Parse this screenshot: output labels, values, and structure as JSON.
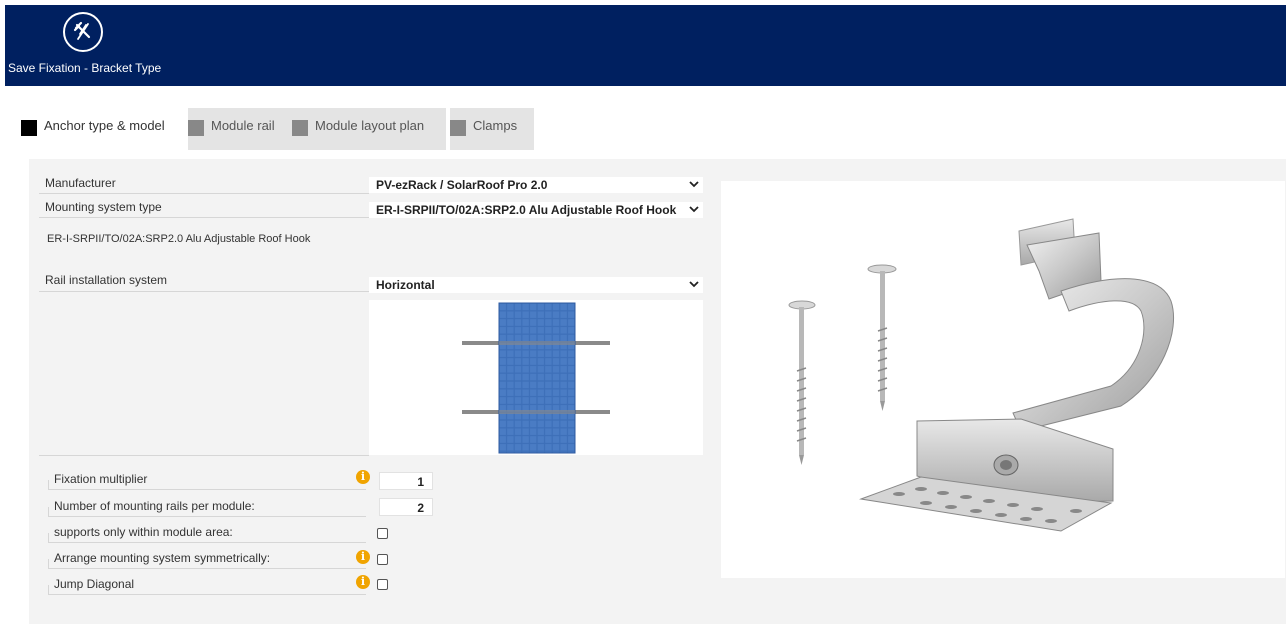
{
  "header": {
    "title": "Save Fixation - Bracket Type",
    "logo_icon": "wrench-screw-icon",
    "bg_color": "#002060"
  },
  "tabs": [
    {
      "label": "Anchor type & model",
      "active": true
    },
    {
      "label": "Module rail",
      "active": false
    },
    {
      "label": "Module layout plan",
      "active": false
    },
    {
      "label": "Clamps",
      "active": false
    }
  ],
  "form": {
    "manufacturer": {
      "label": "Manufacturer",
      "value": "PV-ezRack / SolarRoof Pro 2.0"
    },
    "mounting_type": {
      "label": "Mounting system type",
      "value": "ER-I-SRPII/TO/02A:SRP2.0 Alu Adjustable Roof Hook"
    },
    "selected_product": "ER-I-SRPII/TO/02A:SRP2.0 Alu Adjustable Roof Hook",
    "rail_system": {
      "label": "Rail installation system",
      "value": "Horizontal"
    }
  },
  "options": {
    "fixation_multiplier": {
      "label": "Fixation multiplier",
      "value": "1"
    },
    "rails_per_module": {
      "label": "Number of mounting rails per module:",
      "value": "2"
    },
    "supports_within_area": {
      "label": "supports only within module area:",
      "checked": false
    },
    "arrange_symmetric": {
      "label": "Arrange mounting system symmetrically:",
      "checked": false
    },
    "jump_diagonal": {
      "label": "Jump Diagonal",
      "checked": false
    }
  },
  "colors": {
    "info_icon": "#f0a400",
    "panel_cell": "#3d6fb8"
  }
}
